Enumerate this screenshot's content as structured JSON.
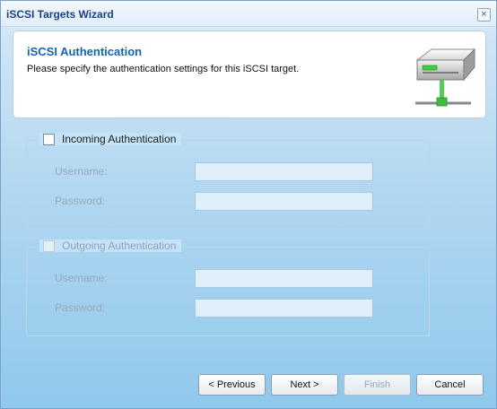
{
  "window": {
    "title": "iSCSI Targets Wizard"
  },
  "header": {
    "title": "iSCSI Authentication",
    "description": "Please specify the authentication settings for this iSCSI target."
  },
  "incoming": {
    "label": "Incoming Authentication",
    "checked": false,
    "enabled": true,
    "username_label": "Username:",
    "username_value": "",
    "password_label": "Password:",
    "password_value": ""
  },
  "outgoing": {
    "label": "Outgoing Authentication",
    "checked": false,
    "enabled": false,
    "username_label": "Username:",
    "username_value": "",
    "password_label": "Password:",
    "password_value": ""
  },
  "buttons": {
    "previous": "< Previous",
    "next": "Next >",
    "finish": "Finish",
    "cancel": "Cancel"
  },
  "icons": {
    "close": "close-icon",
    "target": "storage-server-icon"
  }
}
